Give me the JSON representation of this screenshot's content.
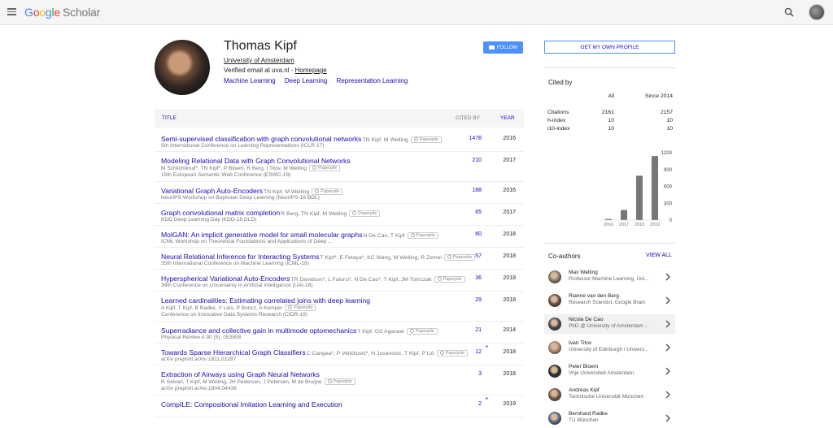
{
  "header": {
    "logo_letters": [
      "G",
      "o",
      "o",
      "g",
      "l",
      "e"
    ],
    "logo_suffix": "Scholar"
  },
  "profile": {
    "name": "Thomas Kipf",
    "affiliation": "University of Amsterdam",
    "verified_text": "Verified email at uva.nl - ",
    "homepage_label": "Homepage",
    "interests": [
      "Machine Learning",
      "Deep Learning",
      "Representation Learning"
    ],
    "follow_label": "FOLLOW"
  },
  "table": {
    "col_title": "TITLE",
    "col_cited": "CITED BY",
    "col_year": "YEAR",
    "paperpile_label": "Paperpile",
    "rows": [
      {
        "title": "Semi-supervised classification with graph convolutional networks",
        "authors": "TN Kipf, M Welling",
        "lines": [
          "5th International Conference on Learning Representations (ICLR-17)"
        ],
        "cites": "1478",
        "year": "2016",
        "star": ""
      },
      {
        "title": "Modeling Relational Data with Graph Convolutional Networks",
        "authors": "",
        "lines": [
          "M Schlichtkrull*, TN Kipf*, P Bloem, R Berg, I Titov, M Welling",
          "15th European Semantic Web Conference (ESWC-18)"
        ],
        "cites": "210",
        "year": "2017",
        "star": ""
      },
      {
        "title": "Variational Graph Auto-Encoders",
        "authors": "TN Kipf, M Welling",
        "lines": [
          "NeurIPS Workshop on Bayesian Deep Learning (NeurIPS-16 BDL)"
        ],
        "cites": "188",
        "year": "2016",
        "star": ""
      },
      {
        "title": "Graph convolutional matrix completion",
        "authors": "R Berg, TN Kipf, M Welling",
        "lines": [
          "KDD Deep Learning Day (KDD-18 DLD)"
        ],
        "cites": "65",
        "year": "2017",
        "star": ""
      },
      {
        "title": "MolGAN: An implicit generative model for small molecular graphs",
        "authors": "N De Cao, T Kipf",
        "lines": [
          "ICML Workshop on Theoretical Foundations and Applications of Deep ..."
        ],
        "cites": "60",
        "year": "2018",
        "star": ""
      },
      {
        "title": "Neural Relational Inference for Interacting Systems",
        "authors": "T Kipf*, E Fetaya*, KC Wang, M Welling, R Zemel",
        "lines": [
          "35th International Conference on Machine Learning (ICML-18)"
        ],
        "cites": "57",
        "year": "2018",
        "star": ""
      },
      {
        "title": "Hyperspherical Variational Auto-Encoders",
        "authors": "TR Davidson*, L Falorsi*, N De Cao*, T Kipf, JM Tomczak",
        "lines": [
          "34th Conference on Uncertainty in Artificial Intelligence (UAI-18)"
        ],
        "cites": "36",
        "year": "2018",
        "star": ""
      },
      {
        "title": "Learned cardinalities: Estimating correlated joins with deep learning",
        "authors": "",
        "lines": [
          "A Kipf, T Kipf, B Radke, V Leis, P Boncz, A Kemper",
          "Conference on Innovative Data Systems Research (CIDR-19)"
        ],
        "cites": "29",
        "year": "2018",
        "star": ""
      },
      {
        "title": "Superradiance and collective gain in multimode optomechanics",
        "authors": "T Kipf, GS Agarwal",
        "lines": [
          "Physical Review A 90 (5), 053808"
        ],
        "cites": "21",
        "year": "2014",
        "star": ""
      },
      {
        "title": "Towards Sparse Hierarchical Graph Classifiers",
        "authors": "C Cangea*, P Veličković*, N Jovanović, T Kipf, P Liò",
        "lines": [
          "arXiv preprint arXiv:1811.01287"
        ],
        "cites": "12",
        "year": "2018",
        "star": "*"
      },
      {
        "title": "Extraction of Airways using Graph Neural Networks",
        "authors": "",
        "lines": [
          "R Selvan, T Kipf, M Welling, JH Pedersen, J Petersen, M de Bruijne",
          "arXiv preprint arXiv:1804.04436"
        ],
        "cites": "3",
        "year": "2018",
        "star": ""
      },
      {
        "title": "CompILE: Compositional Imitation Learning and Execution",
        "authors": "",
        "lines": [],
        "cites": "2",
        "year": "2019",
        "star": "*"
      }
    ]
  },
  "sidebar": {
    "own_profile_label": "GET MY OWN PROFILE",
    "cited_by_label": "Cited by",
    "stats_header": {
      "all": "All",
      "since": "Since 2014"
    },
    "stats": [
      {
        "label": "Citations",
        "all": "2161",
        "since": "2157"
      },
      {
        "label": "h-index",
        "all": "10",
        "since": "10"
      },
      {
        "label": "i10-index",
        "all": "10",
        "since": "10"
      }
    ],
    "coauthors_label": "Co-authors",
    "view_all_label": "VIEW ALL",
    "coauthors": [
      {
        "name": "Max Welling",
        "desc": "Professor Machine Learning, Uni...",
        "color": "#8a7a6a"
      },
      {
        "name": "Rianne van den Berg",
        "desc": "Research Scientist, Google Brain",
        "color": "#6a5040"
      },
      {
        "name": "Nicola De Cao",
        "desc": "PhD @ University of Amsterdam ...",
        "color": "#4a4a4a"
      },
      {
        "name": "Ivan Titov",
        "desc": "University of Edinburgh / Univers...",
        "color": "#b08a70"
      },
      {
        "name": "Peter Bloem",
        "desc": "Vrije Universiteit Amsterdam",
        "color": "#303030"
      },
      {
        "name": "Andreas Kipf",
        "desc": "Technische Universität München",
        "color": "#7a5a48"
      },
      {
        "name": "Bernhard Radke",
        "desc": "TU München",
        "color": "#5a6a8a"
      }
    ]
  },
  "chart_data": {
    "type": "bar",
    "categories": [
      "2016",
      "2017",
      "2018",
      "2019"
    ],
    "values": [
      20,
      180,
      790,
      1140
    ],
    "yticks": [
      "1200",
      "900",
      "600",
      "300",
      "0"
    ],
    "ylim": [
      0,
      1200
    ],
    "bar_color": "#777777"
  }
}
